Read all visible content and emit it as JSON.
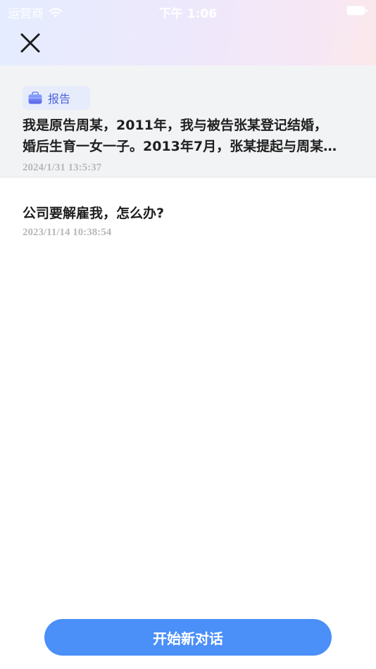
{
  "status_bar": {
    "carrier": "运营商",
    "time": "下午 1:06"
  },
  "header": {
    "close_icon": "close-icon"
  },
  "conversations": [
    {
      "tag": "报告",
      "tag_icon": "briefcase-icon",
      "line1": "我是原告周某，2011年，我与被告张某登记结婚，",
      "line2": "婚后生育一女一子。2013年7月，张某提起与周某…",
      "time": "2024/1/31 13:5:37"
    },
    {
      "text": "公司要解雇我，怎么办?",
      "time": "2023/11/14 10:38:54"
    }
  ],
  "footer": {
    "new_chat_label": "开始新对话"
  },
  "colors": {
    "accent": "#4b8ff8",
    "tag_text": "#4e63d8",
    "tag_bg": "#e6ecfb",
    "timestamp": "#b7b8bd"
  }
}
